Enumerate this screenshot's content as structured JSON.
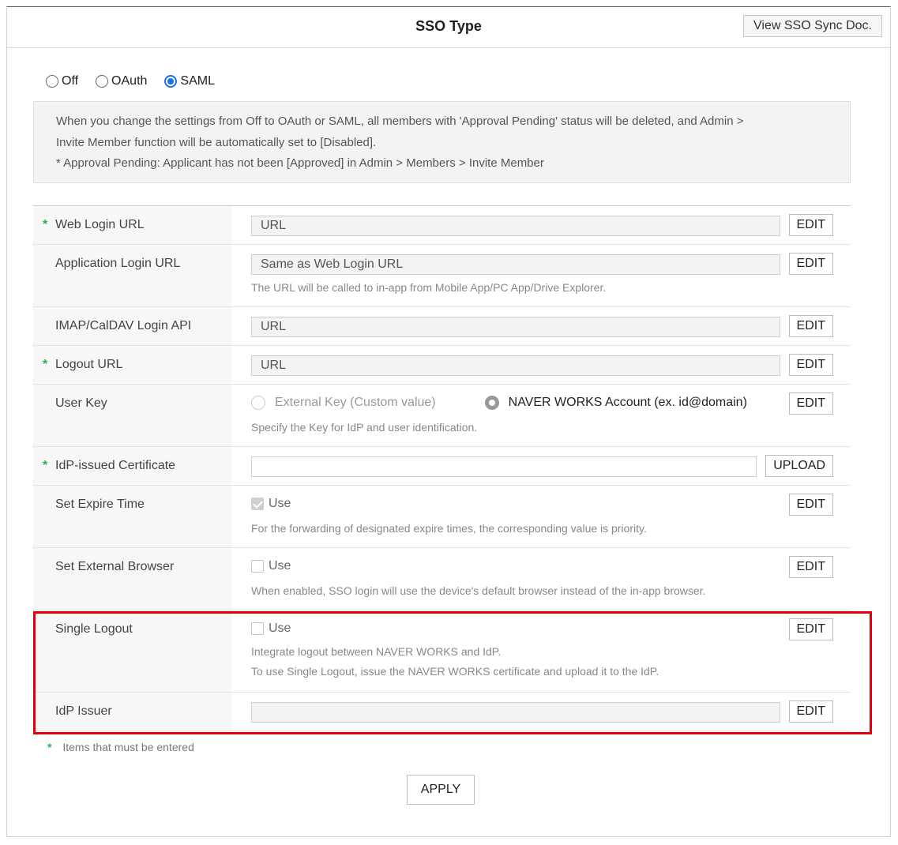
{
  "header": {
    "title": "SSO Type",
    "doc_button": "View SSO Sync Doc."
  },
  "sso_type": {
    "options": [
      "Off",
      "OAuth",
      "SAML"
    ],
    "selected": "SAML"
  },
  "notice": {
    "line1": "When you change the settings from Off to OAuth or SAML, all members with 'Approval Pending' status will be deleted, and Admin >",
    "line2": "Invite Member function will be automatically set to [Disabled].",
    "line3": "* Approval Pending: Applicant has not been [Approved] in Admin > Members > Invite Member"
  },
  "rows": {
    "web_login": {
      "label": "Web Login URL",
      "required": "*",
      "value": "URL",
      "button": "EDIT"
    },
    "app_login": {
      "label": "Application Login URL",
      "value": "Same as Web Login URL",
      "help": "The URL will be called to in-app from Mobile App/PC App/Drive Explorer.",
      "button": "EDIT"
    },
    "imap": {
      "label": "IMAP/CalDAV Login API",
      "value": "URL",
      "button": "EDIT"
    },
    "logout": {
      "label": "Logout URL",
      "required": "*",
      "value": "URL",
      "button": "EDIT"
    },
    "user_key": {
      "label": "User Key",
      "option1": "External Key (Custom value)",
      "option2": "NAVER WORKS Account (ex. id@domain)",
      "selected": "NAVER WORKS Account (ex. id@domain)",
      "help": "Specify the Key for IdP and user identification.",
      "button": "EDIT"
    },
    "certificate": {
      "label": "IdP-issued Certificate",
      "required": "*",
      "value": "",
      "button": "UPLOAD"
    },
    "expire": {
      "label": "Set Expire Time",
      "check": "Use",
      "checked": true,
      "help": "For the forwarding of designated expire times, the corresponding value is priority.",
      "button": "EDIT"
    },
    "external_browser": {
      "label": "Set External Browser",
      "check": "Use",
      "checked": false,
      "help": "When enabled, SSO login will use the device's default browser instead of the in-app browser.",
      "button": "EDIT"
    },
    "single_logout": {
      "label": "Single Logout",
      "check": "Use",
      "checked": false,
      "help1": "Integrate logout between NAVER WORKS and IdP.",
      "help2": "To use Single Logout, issue the NAVER WORKS certificate and upload it to the IdP.",
      "button": "EDIT"
    },
    "idp_issuer": {
      "label": "IdP Issuer",
      "value": "",
      "button": "EDIT"
    }
  },
  "footer": {
    "required_mark": "*",
    "required_note": "Items that must be entered",
    "apply_button": "APPLY"
  },
  "colors": {
    "accent": "#1a73e8",
    "required": "#2bb24c",
    "highlight": "#e0000c"
  }
}
